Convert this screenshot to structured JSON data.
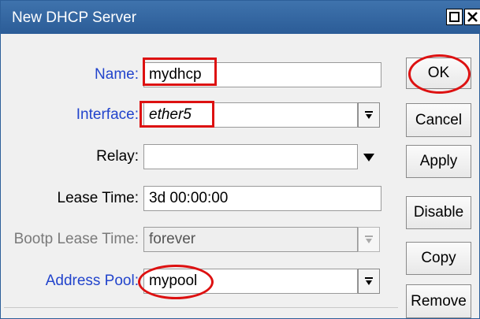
{
  "window": {
    "title": "New DHCP Server"
  },
  "form": {
    "name_label": "Name:",
    "name_value": "mydhcp",
    "interface_label": "Interface:",
    "interface_value": "ether5",
    "relay_label": "Relay:",
    "relay_value": "",
    "lease_time_label": "Lease Time:",
    "lease_time_value": "3d 00:00:00",
    "bootp_label": "Bootp Lease Time:",
    "bootp_value": "forever",
    "pool_label": "Address Pool:",
    "pool_value": "mypool"
  },
  "buttons": {
    "ok": "OK",
    "cancel": "Cancel",
    "apply": "Apply",
    "disable": "Disable",
    "copy": "Copy",
    "remove": "Remove"
  },
  "colors": {
    "title_bar": "#2f62a0",
    "highlight": "#dd1111",
    "label_blue": "#2244cc"
  }
}
